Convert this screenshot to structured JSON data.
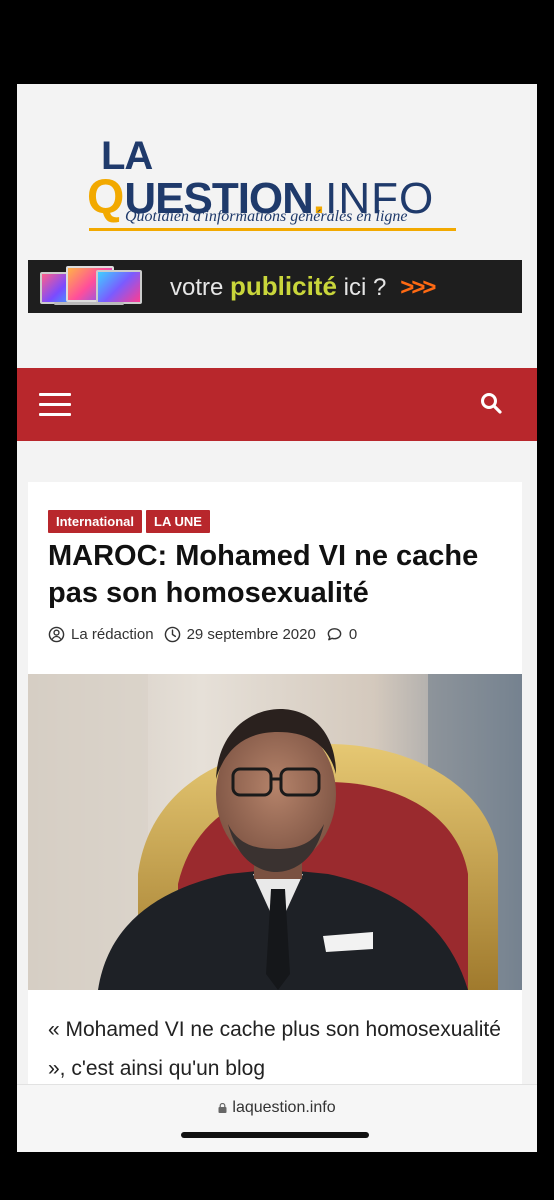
{
  "site": {
    "logo_line1": "LA",
    "logo_q": "Q",
    "logo_main": "UESTION",
    "logo_dot": ".",
    "logo_info": "INFO",
    "tagline": "Quotidien d'informations générales en ligne"
  },
  "ad": {
    "text_pre": "votre ",
    "text_strong": "publicité",
    "text_post": " ici ?",
    "arrows": ">>>"
  },
  "nav": {
    "menu_icon": "hamburger-menu-icon",
    "search_icon": "search-icon"
  },
  "article": {
    "tags": [
      {
        "label": "International"
      },
      {
        "label": "LA UNE"
      }
    ],
    "title": "MAROC: Mohamed VI ne cache pas son homosexualité",
    "author": "La rédaction",
    "date": "29 septembre 2020",
    "comments": "0",
    "lede": "« Mohamed VI ne cache plus son homosexualité », c'est ainsi qu'un blog"
  },
  "browser": {
    "url": "laquestion.info"
  },
  "colors": {
    "brand_red": "#b8272c",
    "logo_blue": "#1f3a6b",
    "logo_gold": "#f2a900",
    "ad_green": "#c9d63b",
    "ad_orange": "#ff6a13"
  }
}
